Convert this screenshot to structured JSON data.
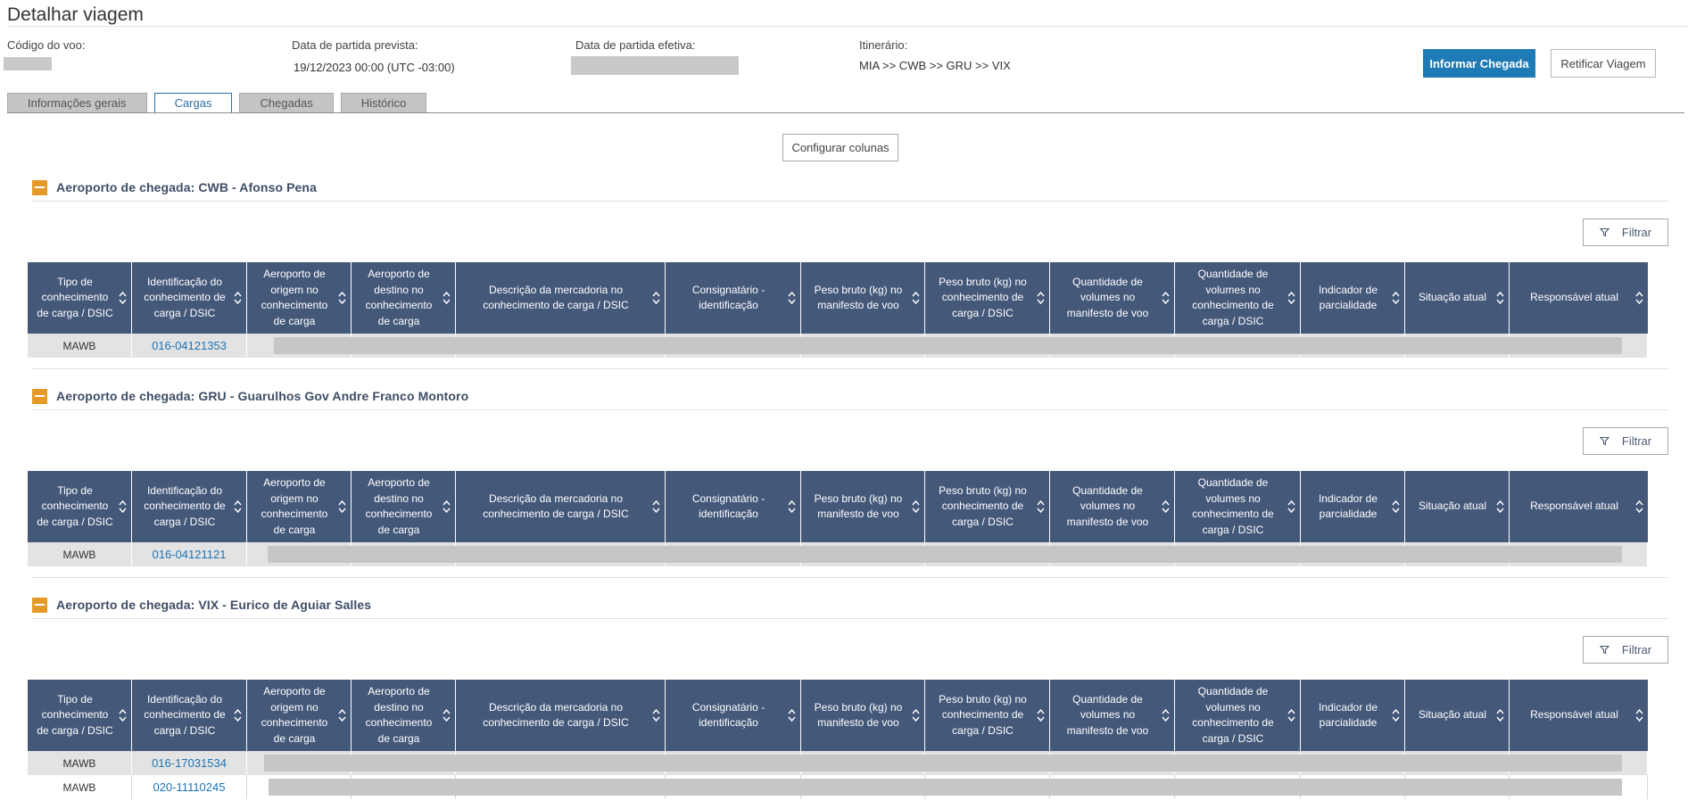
{
  "page": {
    "title": "Detalhar viagem"
  },
  "info": {
    "flight_code_label": "Código do voo:",
    "planned_departure_label": "Data de partida prevista:",
    "planned_departure_value": "19/12/2023 00:00 (UTC -03:00)",
    "actual_departure_label": "Data de partida efetiva:",
    "itinerary_label": "Itinerário:",
    "itinerary_value": "MIA >> CWB >> GRU >> VIX"
  },
  "actions": {
    "report_arrival": "Informar Chegada",
    "rectify_trip": "Retificar Viagem",
    "configure_columns": "Configurar colunas",
    "filter": "Filtrar"
  },
  "tabs": [
    {
      "label": "Informações gerais",
      "active": false
    },
    {
      "label": "Cargas",
      "active": true
    },
    {
      "label": "Chegadas",
      "active": false
    },
    {
      "label": "Histórico",
      "active": false
    }
  ],
  "columns": [
    "Tipo de conhecimento de carga / DSIC",
    "Identificação do conhecimento de carga / DSIC",
    "Aeroporto de origem no conhecimento de carga",
    "Aeroporto de destino no conhecimento de carga",
    "Descrição da mercadoria no conhecimento de carga / DSIC",
    "Consignatário - identificação",
    "Peso bruto (kg) no manifesto de voo",
    "Peso bruto (kg) no conhecimento de carga / DSIC",
    "Quantidade de volumes no manifesto de voo",
    "Quantidade de volumes no conhecimento de carga / DSIC",
    "Indicador de parcialidade",
    "Situação atual",
    "Responsável atual"
  ],
  "sections": [
    {
      "title": "Aeroporto de chegada: CWB - Afonso Pena",
      "rows": [
        {
          "type": "MAWB",
          "id": "016-04121353"
        }
      ]
    },
    {
      "title": "Aeroporto de chegada: GRU - Guarulhos Gov Andre Franco Montoro",
      "rows": [
        {
          "type": "MAWB",
          "id": "016-04121121"
        }
      ]
    },
    {
      "title": "Aeroporto de chegada: VIX - Eurico de Aguiar Salles",
      "rows": [
        {
          "type": "MAWB",
          "id": "016-17031534"
        },
        {
          "type": "MAWB",
          "id": "020-11110245"
        }
      ]
    }
  ],
  "colors": {
    "header_bg": "#44587a",
    "primary": "#1f7bb5",
    "collapse": "#e59a28",
    "link": "#1e73b4"
  }
}
